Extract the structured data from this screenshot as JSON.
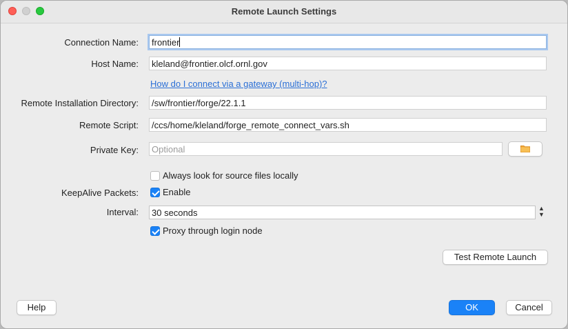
{
  "window": {
    "title": "Remote Launch Settings"
  },
  "form": {
    "connection_name": {
      "label": "Connection Name:",
      "value": "frontier"
    },
    "host_name": {
      "label": "Host Name:",
      "value": "kleland@frontier.olcf.ornl.gov"
    },
    "gateway_link": "How do I connect via a gateway (multi-hop)?",
    "install_dir": {
      "label": "Remote Installation Directory:",
      "value": "/sw/frontier/forge/22.1.1"
    },
    "remote_script": {
      "label": "Remote Script:",
      "value": "/ccs/home/kleland/forge_remote_connect_vars.sh"
    },
    "private_key": {
      "label": "Private Key:",
      "value": "",
      "placeholder": "Optional",
      "browse_icon": "folder-icon"
    },
    "source_local": {
      "label": "Always look for source files locally",
      "checked": false
    },
    "keepalive": {
      "label": "KeepAlive Packets:",
      "checkbox_label": "Enable",
      "checked": true
    },
    "interval": {
      "label": "Interval:",
      "value": "30 seconds"
    },
    "proxy": {
      "label": "Proxy through login node",
      "checked": true
    }
  },
  "buttons": {
    "test": "Test Remote Launch",
    "help": "Help",
    "ok": "OK",
    "cancel": "Cancel"
  },
  "colors": {
    "accent": "#1a82f7",
    "link": "#2a6fd6"
  }
}
